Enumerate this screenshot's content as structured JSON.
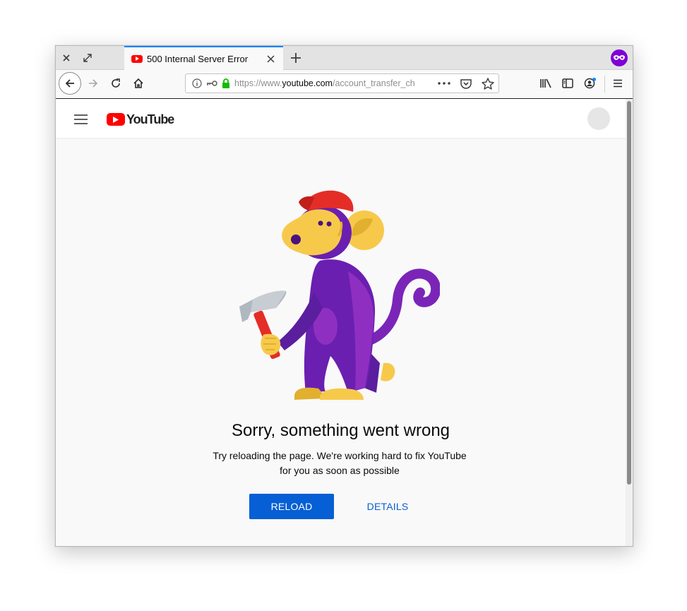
{
  "browser": {
    "tab": {
      "title": "500 Internal Server Error"
    },
    "url": {
      "prefix": "https://www.",
      "domain": "youtube.com",
      "path": "/account_transfer_ch"
    }
  },
  "page": {
    "error": {
      "title": "Sorry, something went wrong",
      "message": "Try reloading the page. We're working hard to fix YouTube for you as soon as possible"
    },
    "buttons": {
      "reload": "RELOAD",
      "details": "DETAILS"
    },
    "logo_text": "YouTube"
  },
  "colors": {
    "accent": "#065fd4",
    "brand": "#ff0000",
    "monkey_purple": "#6a1fb0",
    "monkey_yellow": "#f7c94b",
    "cap_red": "#e52d27"
  },
  "icons": [
    "close-icon",
    "maximize-icon",
    "youtube-favicon",
    "tab-close-icon",
    "plus-icon",
    "private-browsing-icon",
    "back-arrow-icon",
    "forward-arrow-icon",
    "reload-icon",
    "home-icon",
    "info-icon",
    "key-icon",
    "lock-icon",
    "more-icon",
    "pocket-icon",
    "star-icon",
    "library-icon",
    "sidebar-icon",
    "account-icon",
    "menu-icon",
    "hamburger-icon"
  ]
}
